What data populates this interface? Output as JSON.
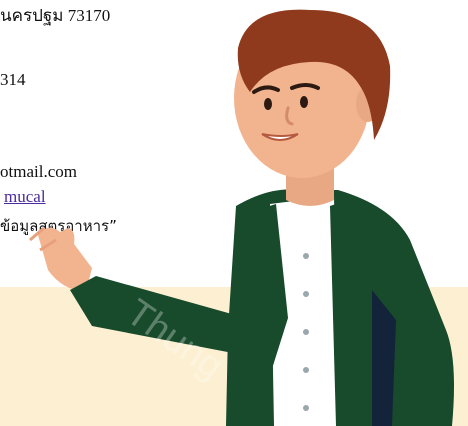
{
  "contact": {
    "address_line": "นครปฐม 73170",
    "phone_fragment": "314",
    "email_fragment": "otmail.com",
    "link_fragment": "mucal",
    "quote_fragment": "ข้อมูลสูตรอาหาร”"
  },
  "illustration": {
    "watermark_text": "Thung",
    "colors": {
      "band": "#fdf0d2",
      "jacket": "#184a2c",
      "shirt": "#ffffff",
      "skin": "#f2b48f",
      "hair": "#8f3a1c",
      "link": "#4b2a9e"
    }
  }
}
